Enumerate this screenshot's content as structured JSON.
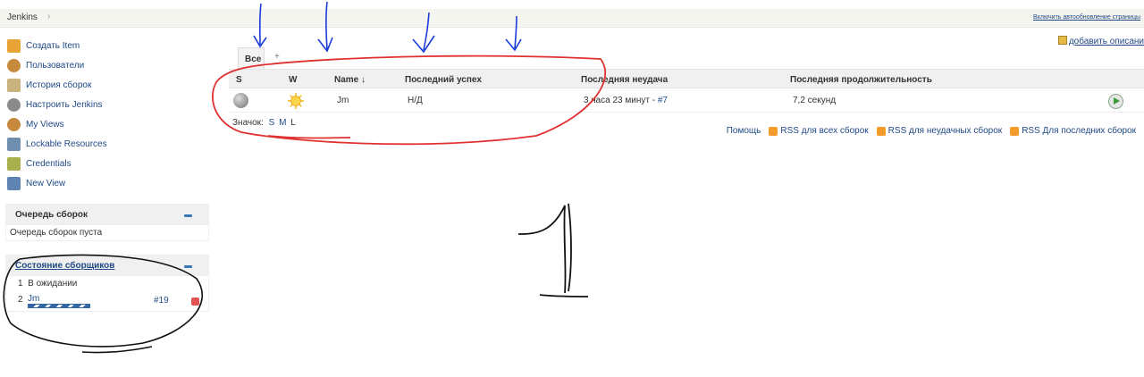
{
  "breadcrumb": {
    "root": "Jenkins",
    "separator": "›"
  },
  "autorefresh": "Включить автообновление страницы",
  "add_description": "добавить описани",
  "sidebar": {
    "tasks": [
      {
        "label": "Создать Item",
        "icon": "folder-new-icon",
        "color": "#e8a536"
      },
      {
        "label": "Пользователи",
        "icon": "users-icon",
        "color": "#c7893c"
      },
      {
        "label": "История сборок",
        "icon": "notepad-icon",
        "color": "#c9b27c"
      },
      {
        "label": "Настроить Jenkins",
        "icon": "gear-icon",
        "color": "#8a8a8a"
      },
      {
        "label": "My Views",
        "icon": "users-icon",
        "color": "#c7893c"
      },
      {
        "label": "Lockable Resources",
        "icon": "lock-icon",
        "color": "#6f8fb0"
      },
      {
        "label": "Credentials",
        "icon": "key-icon",
        "color": "#a7b04d"
      },
      {
        "label": "New View",
        "icon": "folder-icon",
        "color": "#5f84b3"
      }
    ],
    "queue": {
      "title": "Очередь сборок",
      "empty": "Очередь сборок пуста"
    },
    "executors": {
      "title": "Состояние сборщиков",
      "rows": [
        {
          "num": "1",
          "text": "В ожидании"
        },
        {
          "num": "2",
          "job": "Jm",
          "build": "#19",
          "progress": 0.5
        }
      ]
    }
  },
  "tabs": {
    "all": "Все",
    "add": "+"
  },
  "table": {
    "headers": {
      "s": "S",
      "w": "W",
      "name": "Name",
      "sort": "↓",
      "last_success": "Последний успех",
      "last_failure": "Последняя неудача",
      "last_duration": "Последняя продолжительность"
    },
    "row": {
      "name": "Jm",
      "last_success": "Н/Д",
      "last_failure": "3 часа 23 минут - ",
      "last_failure_link": "#7",
      "last_duration": "7,2 секунд"
    }
  },
  "icon_size": {
    "label": "Значок:",
    "s": "S",
    "m": "M",
    "l": "L"
  },
  "footer": {
    "help": "Помощь",
    "rss_all": "RSS для всех сборок",
    "rss_failed": "RSS для неудачных сборок",
    "rss_latest": "RSS Для последних сборок"
  },
  "annotation": {
    "big_number": "1"
  },
  "colors": {
    "link": "#204a87",
    "annotation_red": "#e03030",
    "annotation_blue": "#1a3cdb",
    "annotation_black": "#111111"
  }
}
